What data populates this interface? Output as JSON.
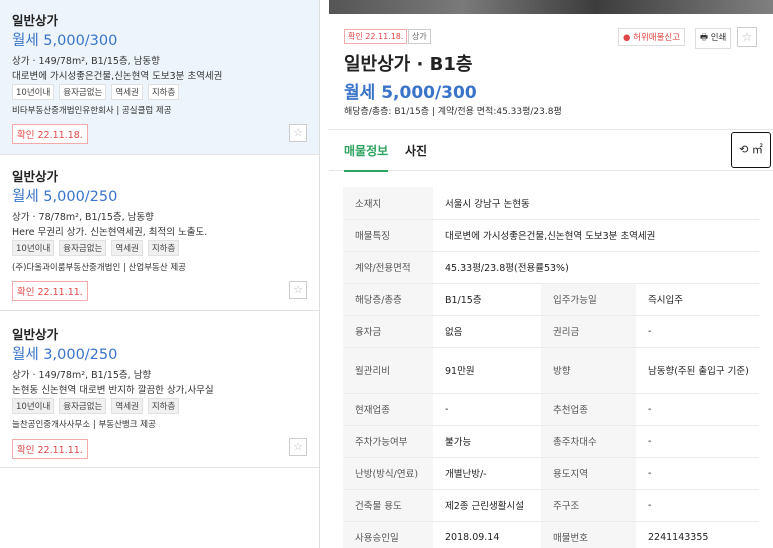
{
  "listings": [
    {
      "type": "일반상가",
      "price": "월세 5,000/300",
      "spec": "상가 · 149/78m², B1/15층, 남동향",
      "desc": "대로변에 가시성좋은건물,신논현역 도보3분 초역세권",
      "tags": [
        "10년이내",
        "융자금없는",
        "역세권",
        "지하층"
      ],
      "agency": "비타부동산중개법인유한회사 | 공실클럽 제공",
      "confirm": "확인 22.11.18.",
      "star": "☆",
      "active": true
    },
    {
      "type": "일반상가",
      "price": "월세 5,000/250",
      "spec": "상가 · 78/78m², B1/15층, 남동향",
      "desc": "Here 무권리 상가. 신논현역세권, 최적의 노출도.",
      "tags": [
        "10년이내",
        "융자금없는",
        "역세권",
        "지하층"
      ],
      "agency": "(주)다올과이룸부동산중개법인 | 산업부동산 제공",
      "confirm": "확인 22.11.11.",
      "star": "☆",
      "active": false
    },
    {
      "type": "일반상가",
      "price": "월세 3,000/250",
      "spec": "상가 · 149/78m², B1/15층, 남향",
      "desc": "논현동 신논현역 대로변 반지하 깔끔한 상가,사무실",
      "tags": [
        "10년이내",
        "융자금없는",
        "역세권",
        "지하층"
      ],
      "agency": "늘찬공인중개사사무소 | 부동산뱅크 제공",
      "confirm": "확인 22.11.11.",
      "star": "☆",
      "active": false
    }
  ],
  "detail": {
    "confirm_badge": "확인 22.11.18.",
    "category_badge": "상가",
    "report_label": "● 허위매물신고",
    "print_label": "🖶 인쇄",
    "fav_icon": "☆",
    "title": "일반상가 · B1층",
    "price": "월세 5,000/300",
    "summary": "해당층/총층: B1/15층 | 계약/전용 면적:45.33평/23.8평",
    "tabs": [
      "매물정보",
      "사진"
    ],
    "unit_toggle": "⟲ ㎡",
    "info": {
      "location_label": "소재지",
      "location": "서울시 강남구 논현동",
      "feature_label": "매물특징",
      "feature": "대로변에 가시성좋은건물,신논현역 도보3분 초역세권",
      "area_label": "계약/전용면적",
      "area": "45.33평/23.8평(전용률53%)",
      "floor_label": "해당층/총층",
      "floor": "B1/15층",
      "movein_label": "입주가능일",
      "movein": "즉시입주",
      "loan_label": "융자금",
      "loan": "없음",
      "premium_label": "권리금",
      "premium": "-",
      "fee_label": "월관리비",
      "fee": "91만원",
      "direction_label": "방향",
      "direction": "남동향(주된 출입구 기준)",
      "current_label": "현재업종",
      "current": "-",
      "recommend_label": "추천업종",
      "recommend": "-",
      "parking_label": "주차가능여부",
      "parking": "불가능",
      "total_parking_label": "총주차대수",
      "total_parking": "-",
      "heating_label": "난방(방식/연료)",
      "heating": "개별난방/-",
      "zone_label": "용도지역",
      "zone": "-",
      "building_use_label": "건축물 용도",
      "building_use": "제2종 근린생활시설",
      "structure_label": "주구조",
      "structure": "-",
      "approval_label": "사용승인일",
      "approval": "2018.09.14",
      "number_label": "매물번호",
      "number": "2241143355"
    }
  }
}
